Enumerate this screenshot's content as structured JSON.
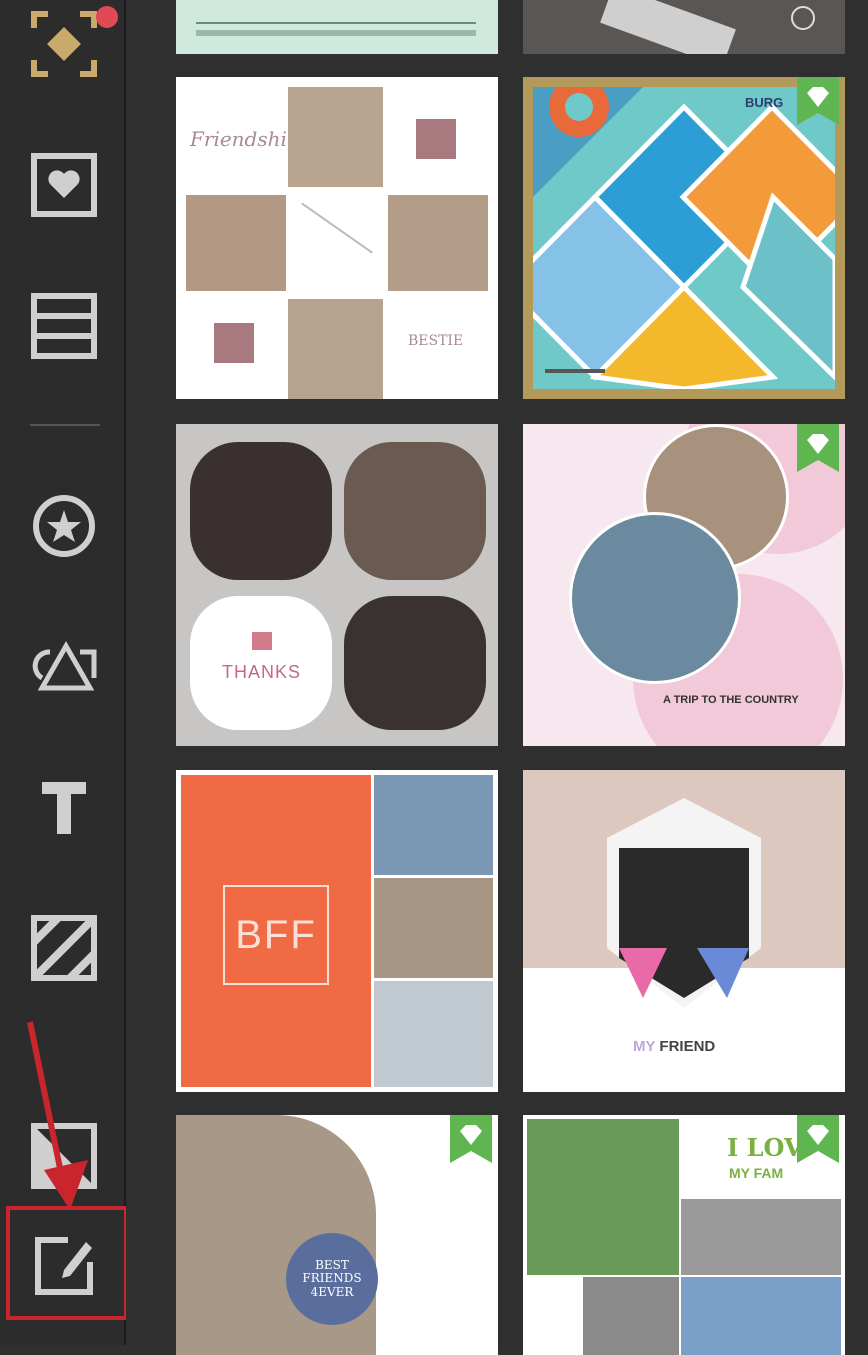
{
  "sidebar": {
    "items": [
      {
        "name": "templates-icon",
        "has_notification": true
      },
      {
        "name": "stickers-heart-icon"
      },
      {
        "name": "layout-icon"
      },
      {
        "name": "badge-star-icon"
      },
      {
        "name": "shapes-icon"
      },
      {
        "name": "text-icon"
      },
      {
        "name": "pattern-icon"
      },
      {
        "name": "background-icon"
      },
      {
        "name": "edit-icon",
        "highlighted": true
      }
    ],
    "annotation_color": "#c8262c",
    "notification_color": "#e04a56"
  },
  "templates": [
    {
      "id": "friendship",
      "texts": {
        "title": "Friendship",
        "corner": "BESTIE"
      }
    },
    {
      "id": "beach-diamonds",
      "premium": true,
      "texts": {
        "corner": "BURG"
      }
    },
    {
      "id": "thanks",
      "texts": {
        "title": "THANKS"
      }
    },
    {
      "id": "trip-country",
      "premium": true,
      "texts": {
        "title": "A TRIP TO THE COUNTRY"
      }
    },
    {
      "id": "bff",
      "texts": {
        "title": "BFF"
      }
    },
    {
      "id": "my-friend",
      "texts": {
        "title_a": "MY",
        "title_b": "FRIEND"
      }
    },
    {
      "id": "best-friends",
      "premium": true,
      "texts": {
        "circle": "BEST\nFRIENDS\n4EVER"
      }
    },
    {
      "id": "family",
      "premium": true,
      "texts": {
        "line1": "I LOV",
        "line2": "MY FAM"
      }
    }
  ],
  "colors": {
    "premium_badge": "#5fb54f",
    "selected_border": "#b49a5a",
    "bff_orange": "#f06a44",
    "gold": "#c9aa6a"
  }
}
